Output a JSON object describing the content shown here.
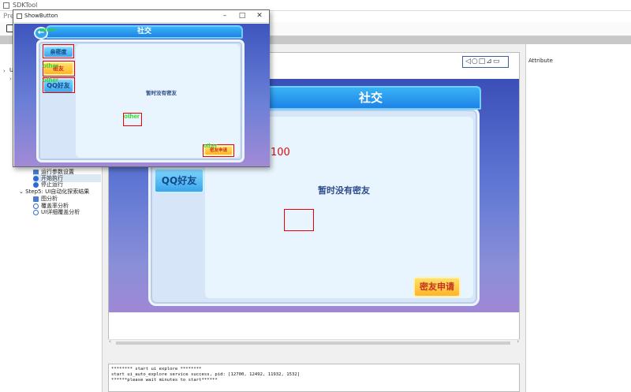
{
  "app": {
    "title": "SDKTool",
    "menu_partial": "Pre"
  },
  "tree": {
    "top_partial": "U",
    "items": [
      {
        "label": "运行参数设置"
      },
      {
        "label": "开始执行"
      },
      {
        "label": "停止运行"
      },
      {
        "label": "Step5: UI自动化探索结果"
      },
      {
        "label": "图分析"
      },
      {
        "label": "覆盖率分析"
      },
      {
        "label": "UI详细覆盖分析"
      }
    ]
  },
  "right_panel": {
    "title": "Attribute"
  },
  "toolbar_icons": "◁○□⊿▭",
  "game": {
    "header": "社交",
    "tab_qq": "QQ好友",
    "empty_text": "暂时没有密友",
    "apply_button": "密友申请",
    "score": "100"
  },
  "popup": {
    "title": "ShowButton",
    "header": "社交",
    "tab1": "亲密度",
    "tab2": "密友",
    "tab3": "QQ好友",
    "empty_text": "暂时没有密友",
    "apply_button": "密友申请",
    "tag_other": "other",
    "tag_return": "return"
  },
  "log": {
    "lines": [
      "******** start ui explore ********",
      "start ui_auto_explore service success, pid: [12700, 12492, 11932, 1532]",
      "******please wait minutes to start******"
    ]
  }
}
